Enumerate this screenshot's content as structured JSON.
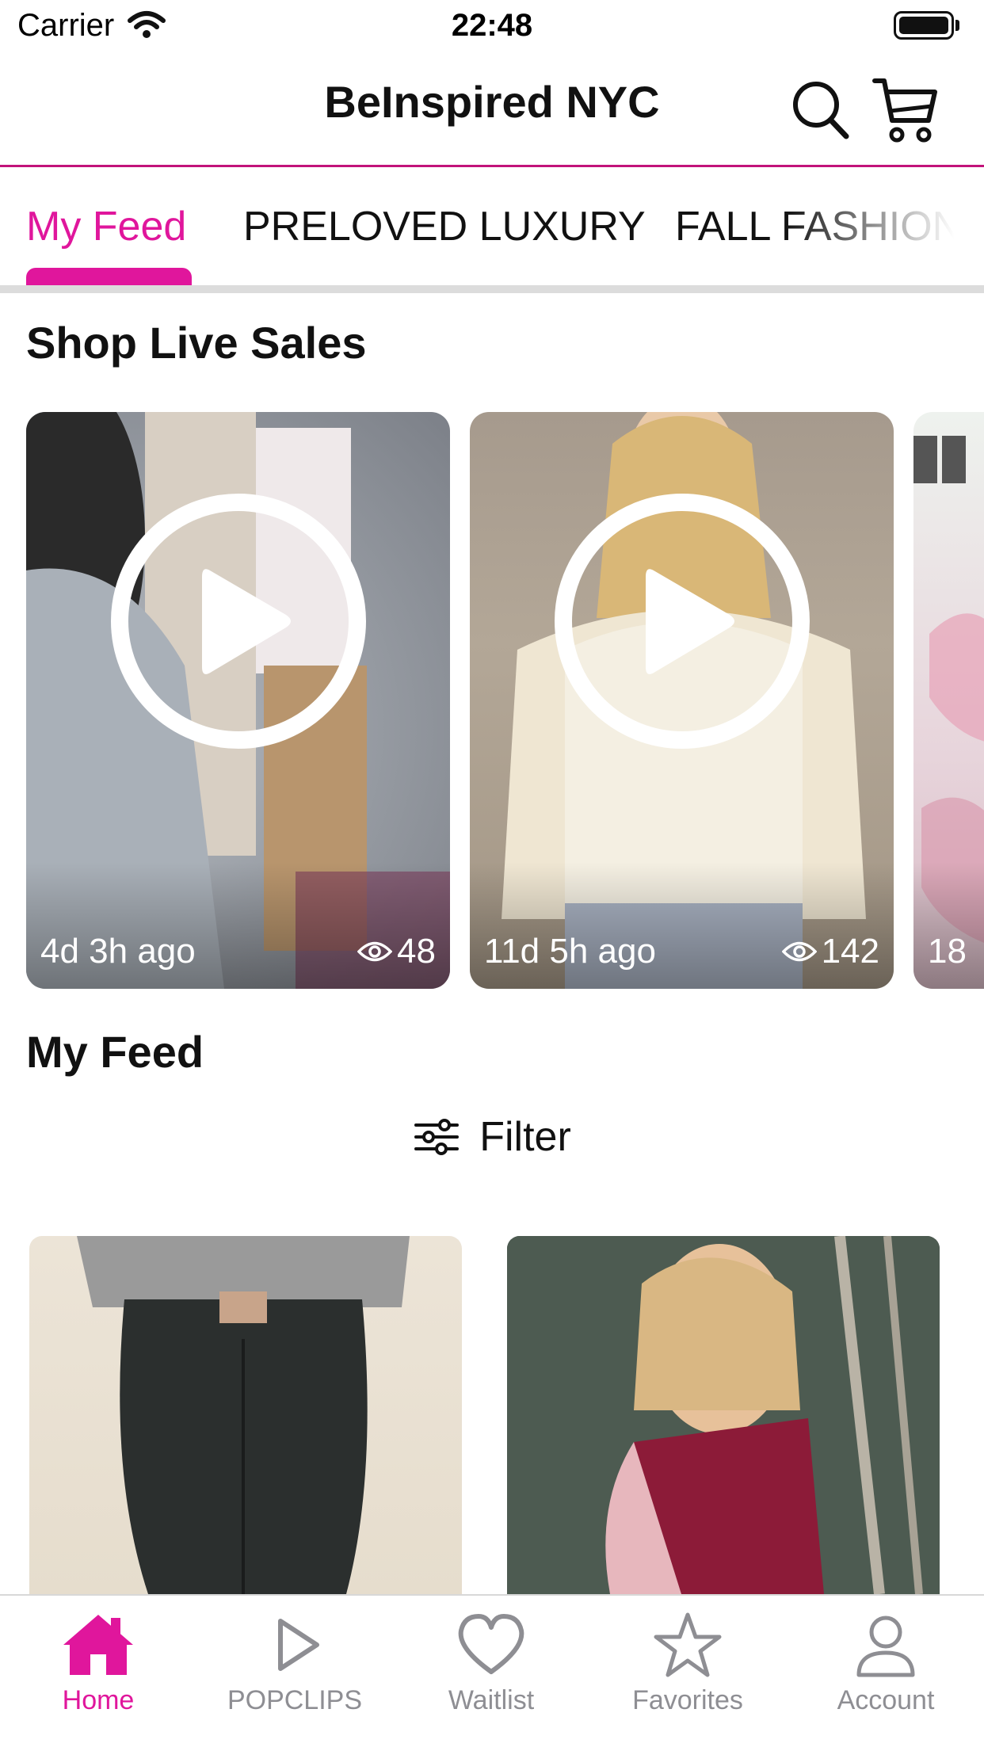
{
  "status_bar": {
    "carrier": "Carrier",
    "time": "22:48"
  },
  "nav": {
    "title": "BeInspired NYC"
  },
  "tabs": [
    {
      "label": "My Feed",
      "active": true
    },
    {
      "label": "PRELOVED LUXURY",
      "active": false
    },
    {
      "label": "FALL FASHION",
      "active": false
    }
  ],
  "live_sales": {
    "title": "Shop Live Sales",
    "cards": [
      {
        "ago": "4d 3h ago",
        "views": "48"
      },
      {
        "ago": "11d 5h ago",
        "views": "142"
      },
      {
        "ago": "18",
        "views": ""
      }
    ]
  },
  "feed": {
    "title": "My Feed",
    "filter_label": "Filter"
  },
  "tabbar": [
    {
      "label": "Home",
      "icon": "home-icon",
      "active": true
    },
    {
      "label": "POPCLIPS",
      "icon": "play-icon",
      "active": false
    },
    {
      "label": "Waitlist",
      "icon": "heart-icon",
      "active": false
    },
    {
      "label": "Favorites",
      "icon": "star-icon",
      "active": false
    },
    {
      "label": "Account",
      "icon": "person-icon",
      "active": false
    }
  ],
  "colors": {
    "accent": "#e0169c",
    "nav_rule": "#c2127a",
    "inactive": "#8e8e93"
  }
}
